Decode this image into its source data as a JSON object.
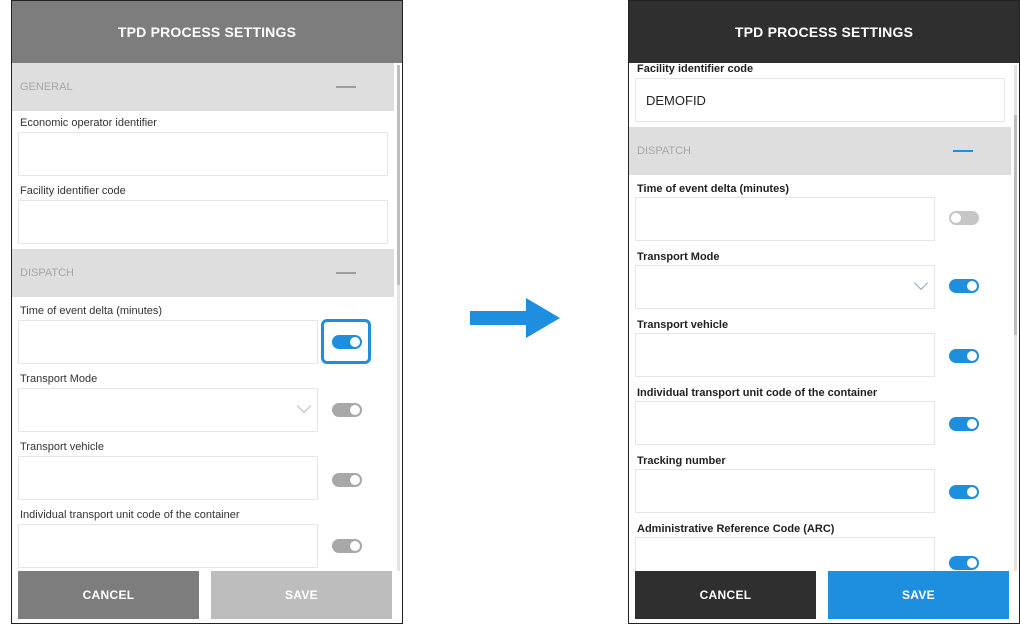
{
  "before": {
    "title": "TPD PROCESS SETTINGS",
    "general_header": "GENERAL",
    "dispatch_header": "DISPATCH",
    "fields": {
      "economic_operator": {
        "label": "Economic operator identifier",
        "value": ""
      },
      "facility_code": {
        "label": "Facility identifier code",
        "value": ""
      },
      "time_delta": {
        "label": "Time of event delta (minutes)",
        "value": "",
        "toggle": "on"
      },
      "transport_mode": {
        "label": "Transport Mode",
        "value": "",
        "toggle": "on"
      },
      "transport_vehicle": {
        "label": "Transport vehicle",
        "value": "",
        "toggle": "on"
      },
      "transport_unit": {
        "label": "Individual transport unit code of the container",
        "value": "",
        "toggle": "on"
      }
    },
    "cancel_label": "CANCEL",
    "save_label": "SAVE"
  },
  "after": {
    "title": "TPD PROCESS SETTINGS",
    "dispatch_header": "DISPATCH",
    "fields": {
      "facility_code": {
        "label": "Facility identifier code",
        "value": "DEMOFID"
      },
      "time_delta": {
        "label": "Time of event delta (minutes)",
        "value": "",
        "toggle": "off"
      },
      "transport_mode": {
        "label": "Transport Mode",
        "value": "",
        "toggle": "on"
      },
      "transport_vehicle": {
        "label": "Transport vehicle",
        "value": "",
        "toggle": "on"
      },
      "transport_unit": {
        "label": "Individual transport unit code of the container",
        "value": "",
        "toggle": "on"
      },
      "tracking_number": {
        "label": "Tracking number",
        "value": "",
        "toggle": "on"
      },
      "arc": {
        "label": "Administrative Reference Code (ARC)",
        "value": "",
        "toggle": "on"
      }
    },
    "cancel_label": "CANCEL",
    "save_label": "SAVE"
  },
  "colors": {
    "accent": "#1e8fde",
    "before_titlebar": "#7d7d7d",
    "after_titlebar": "#2f2f2f",
    "section_header_bg": "#dedede"
  },
  "icons": {
    "collapse": "minus-icon",
    "dropdown": "chevron-down-icon",
    "transition": "right-arrow-icon"
  }
}
